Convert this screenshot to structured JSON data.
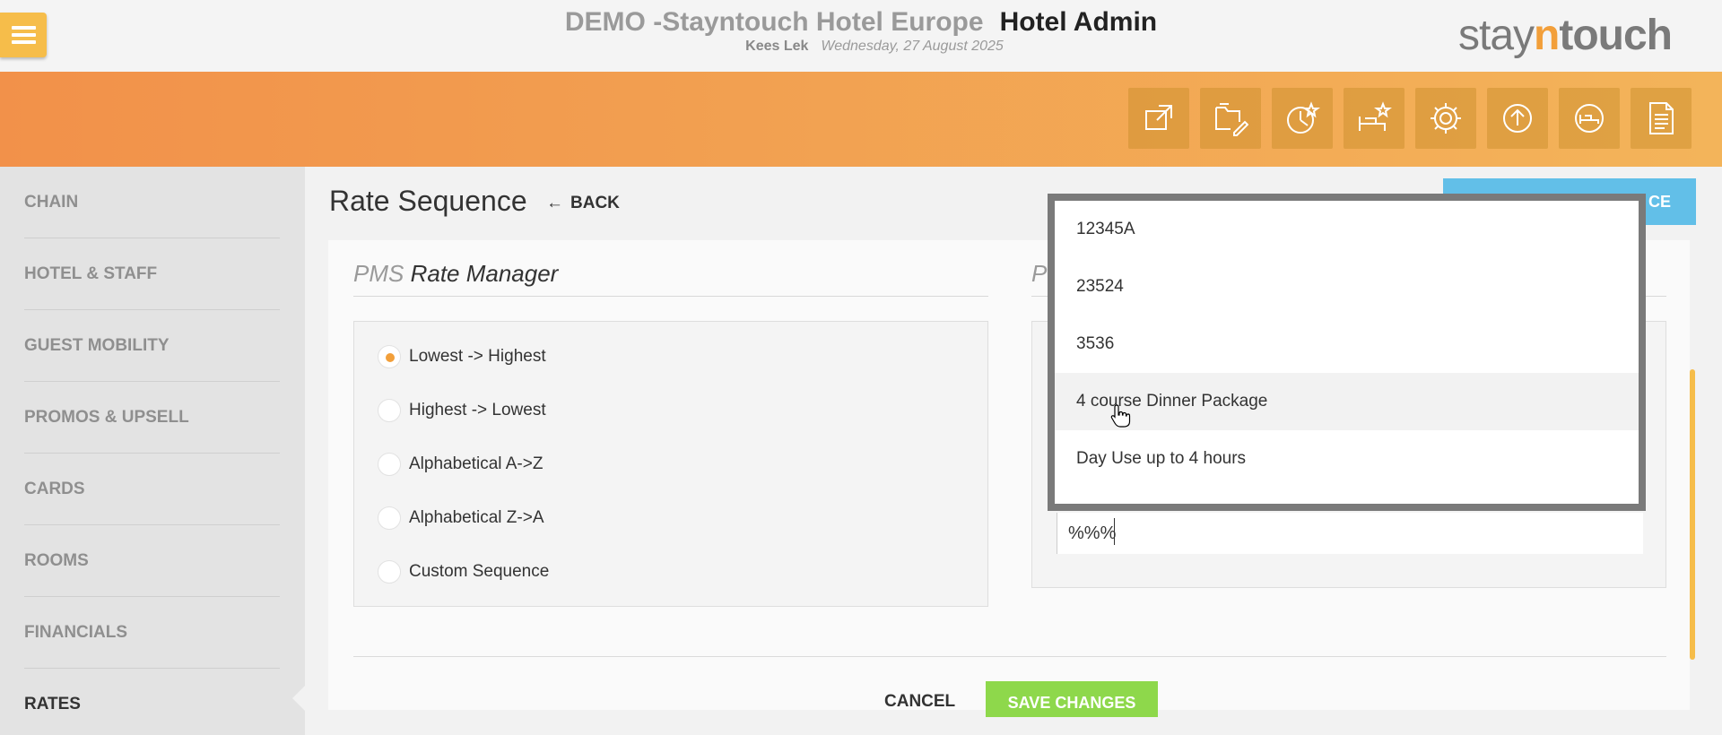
{
  "header": {
    "hotel_name": "DEMO -Stayntouch Hotel Europe",
    "app_name": "Hotel Admin",
    "user_name": "Kees Lek",
    "date": "Wednesday, 27 August 2025",
    "logo": {
      "part1": "stay",
      "part2": "n",
      "part3": "touch"
    }
  },
  "toolbar": {
    "icons": [
      "external-link-icon",
      "folder-edit-icon",
      "star-chart-icon",
      "bed-star-icon",
      "gear-icon",
      "upload-icon",
      "bed-icon",
      "document-icon"
    ]
  },
  "sidebar": {
    "items": [
      {
        "label": "CHAIN"
      },
      {
        "label": "HOTEL & STAFF"
      },
      {
        "label": "GUEST MOBILITY"
      },
      {
        "label": "PROMOS & UPSELL"
      },
      {
        "label": "CARDS"
      },
      {
        "label": "ROOMS"
      },
      {
        "label": "FINANCIALS"
      },
      {
        "label": "RATES"
      }
    ],
    "active": "RATES"
  },
  "page": {
    "title": "Rate Sequence",
    "back_label": "BACK",
    "top_button_label": "CE"
  },
  "left_section": {
    "prefix": "PMS",
    "title": "Rate Manager",
    "options": [
      {
        "label": "Lowest -> Highest",
        "checked": true
      },
      {
        "label": "Highest -> Lowest",
        "checked": false
      },
      {
        "label": "Alphabetical A->Z",
        "checked": false
      },
      {
        "label": "Alphabetical Z->A",
        "checked": false
      },
      {
        "label": "Custom Sequence",
        "checked": false
      }
    ]
  },
  "right_section": {
    "prefix_stub": "P",
    "input_value": "%%%"
  },
  "dropdown": {
    "items": [
      "12345A",
      "23524",
      "3536",
      "4 course Dinner Package",
      "Day Use up to 4 hours"
    ],
    "hovered_index": 3
  },
  "footer": {
    "cancel_label": "CANCEL",
    "save_label": "SAVE CHANGES"
  },
  "colors": {
    "accent_orange": "#f29f3a",
    "menu_yellow": "#f6bd4a",
    "save_green": "#8ed84b",
    "info_blue": "#62bfe8"
  }
}
